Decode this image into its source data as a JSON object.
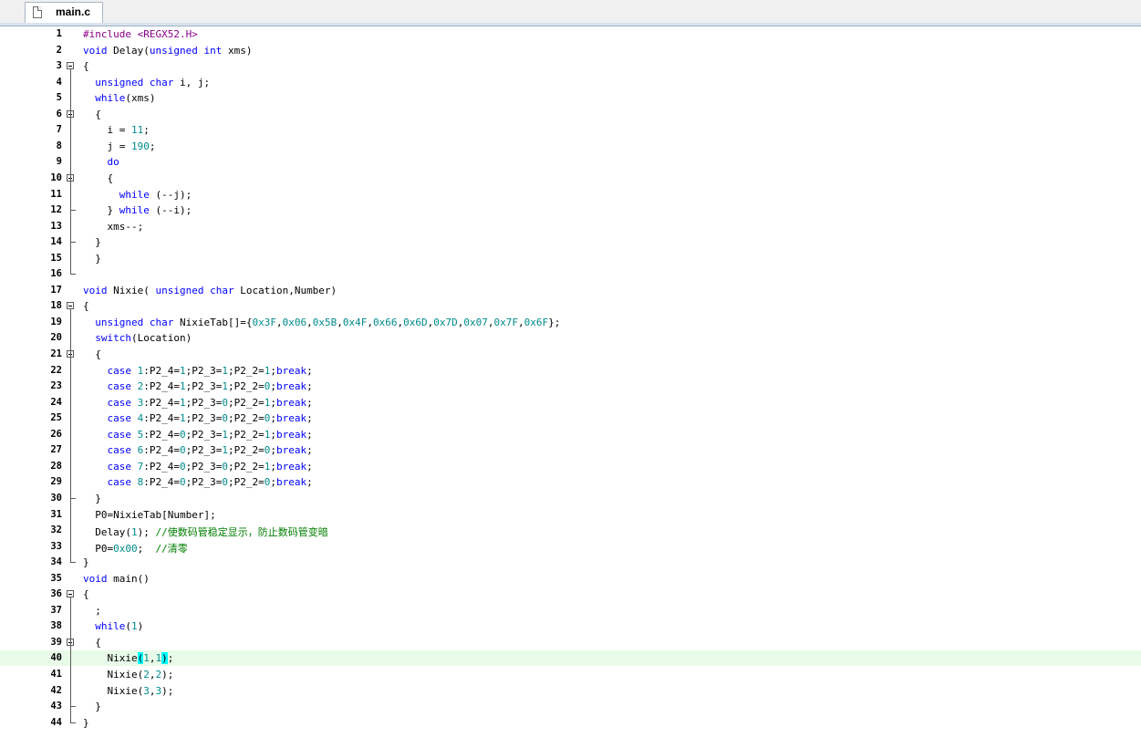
{
  "tab": {
    "label": "main.c",
    "icon": "file-icon"
  },
  "colors": {
    "keyword": "#0000ff",
    "number": "#008b8b",
    "comment": "#008000",
    "preprocessor": "#8b008b",
    "highlight_line": "#e8fbe8",
    "bracket_match": "#00ffff"
  },
  "lines": [
    "#include <REGX52.H>",
    "void Delay(unsigned int xms)",
    "{",
    "  unsigned char i, j;",
    "  while(xms)",
    "  {",
    "    i = 11;",
    "    j = 190;",
    "    do",
    "    {",
    "      while (--j);",
    "    } while (--i);",
    "    xms--;",
    "  }",
    "  }",
    "",
    "void Nixie( unsigned char Location,Number)",
    "{",
    "  unsigned char NixieTab[]={0x3F,0x06,0x5B,0x4F,0x66,0x6D,0x7D,0x07,0x7F,0x6F};",
    "  switch(Location)",
    "  {",
    "    case 1:P2_4=1;P2_3=1;P2_2=1;break;",
    "    case 2:P2_4=1;P2_3=1;P2_2=0;break;",
    "    case 3:P2_4=1;P2_3=0;P2_2=1;break;",
    "    case 4:P2_4=1;P2_3=0;P2_2=0;break;",
    "    case 5:P2_4=0;P2_3=1;P2_2=1;break;",
    "    case 6:P2_4=0;P2_3=1;P2_2=0;break;",
    "    case 7:P2_4=0;P2_3=0;P2_2=1;break;",
    "    case 8:P2_4=0;P2_3=0;P2_2=0;break;",
    "  }",
    "  P0=NixieTab[Number];",
    "  Delay(1); //使数码管稳定显示，防止数码管变暗",
    "  P0=0x00;  //清零",
    "}",
    "void main()",
    "{",
    "  ;",
    "  while(1)",
    "  {",
    "    Nixie(1,1);",
    "    Nixie(2,2);",
    "    Nixie(3,3);",
    "  }",
    "}"
  ],
  "active_line": 40
}
